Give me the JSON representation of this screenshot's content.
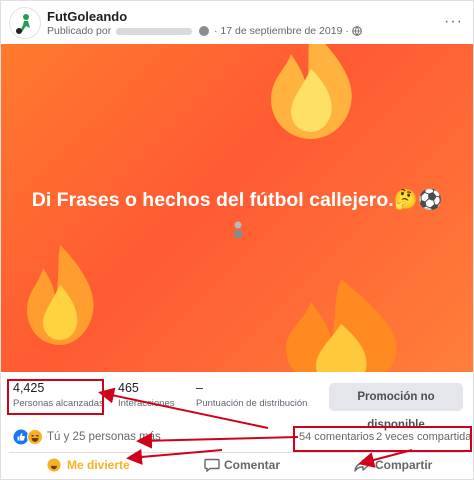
{
  "post": {
    "page_name": "FutGoleando",
    "published_prefix": "Publicado por",
    "date": "· 17 de septiembre de 2019 ·",
    "headline": "Di Frases o hechos del fútbol callejero.🤔⚽",
    "options_label": "···"
  },
  "stats": {
    "reach_value": "4,425",
    "reach_label": "Personas alcanzadas",
    "interactions_value": "465",
    "interactions_label": "Interacciones",
    "distribution_value": "–",
    "distribution_label": "Puntuación de distribución",
    "promo_button": "Promoción no disponible"
  },
  "reactions": {
    "summary": "Tú y 25 personas más",
    "comments": "54 comentarios",
    "shares": "2 veces compartida",
    "icons": [
      "like-icon",
      "haha-icon"
    ]
  },
  "actions": {
    "like": "Me divierte",
    "comment": "Comentar",
    "share": "Compartir"
  },
  "colors": {
    "image_gradient": [
      "#ff7a2e",
      "#ff5a33"
    ],
    "highlight": "#d0021b",
    "like_blue": "#1877f2",
    "haha_yellow": "#f7b125"
  }
}
